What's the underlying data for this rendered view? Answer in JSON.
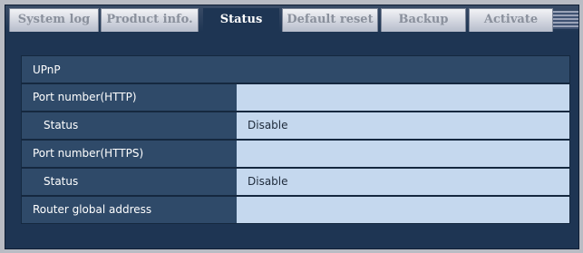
{
  "tabs": [
    {
      "label": "System log"
    },
    {
      "label": "Product info."
    },
    {
      "label": "Status"
    },
    {
      "label": "Default reset"
    },
    {
      "label": "Backup"
    },
    {
      "label": "Activate"
    }
  ],
  "section": {
    "title": "UPnP",
    "rows": [
      {
        "label": "Port number(HTTP)",
        "value": ""
      },
      {
        "label": "Status",
        "value": "Disable"
      },
      {
        "label": "Port number(HTTPS)",
        "value": ""
      },
      {
        "label": "Status",
        "value": "Disable"
      },
      {
        "label": "Router global address",
        "value": ""
      }
    ]
  }
}
